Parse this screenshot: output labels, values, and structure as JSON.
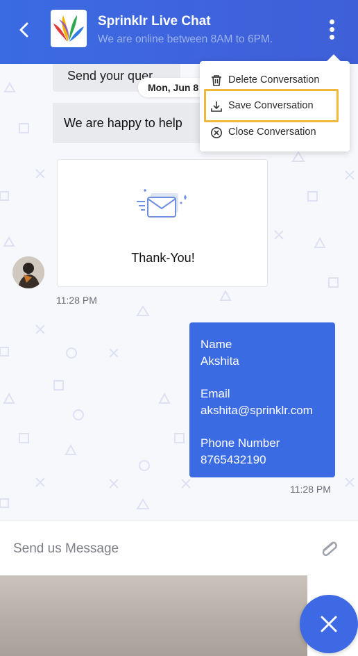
{
  "header": {
    "title": "Sprinklr Live Chat",
    "subtitle": "We are online between 8AM to 6PM."
  },
  "chat": {
    "messages": {
      "partial_bot_message": "Send your quer",
      "date_chip": "Mon, Jun 8",
      "help_message": "We are happy to help",
      "card_text": "Thank-You!",
      "card_time": "11:28 PM",
      "user_form": {
        "name_label": "Name",
        "name_value": "Akshita",
        "email_label": "Email",
        "email_value": "akshita@sprinklr.com",
        "phone_label": "Phone Number",
        "phone_value": "8765432190"
      },
      "user_time": "11:28 PM"
    }
  },
  "menu": {
    "items": [
      {
        "label": "Delete Conversation",
        "icon": "trash-icon"
      },
      {
        "label": "Save Conversation",
        "icon": "download-icon",
        "highlighted": true
      },
      {
        "label": "Close Conversation",
        "icon": "close-circle-icon"
      }
    ]
  },
  "composer": {
    "placeholder": "Send us Message",
    "attach_icon": "paperclip-icon"
  },
  "fab": {
    "icon": "close-icon"
  },
  "colors": {
    "brand_blue": "#3b6be3",
    "highlight": "#efb73b",
    "bot_bubble": "#e9eaee"
  }
}
